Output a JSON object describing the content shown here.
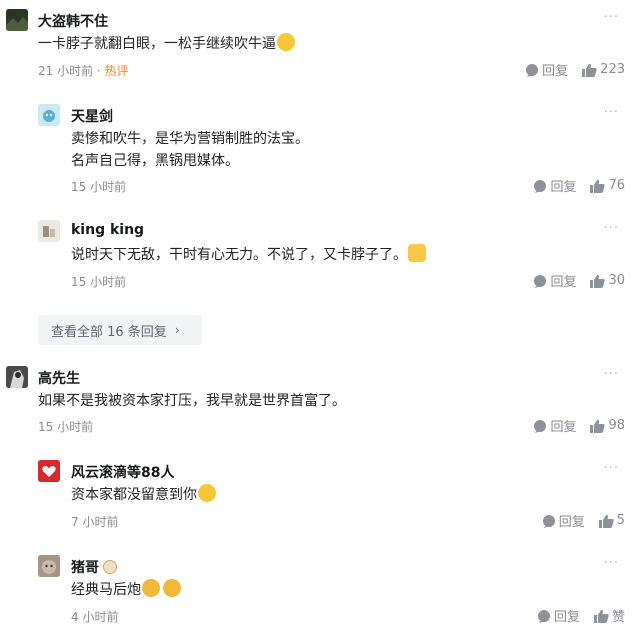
{
  "more_glyph": "···",
  "reply_label": "回复",
  "view_all": {
    "label": "查看全部 16 条回复",
    "chevron": "›"
  },
  "comments": [
    {
      "name": "大盗韩不住",
      "text": "一卡脖子就翻白眼，一松手继续吹牛逼",
      "time": "21 小时前",
      "tag": "热评",
      "likes": "223"
    },
    {
      "name": "天星剑",
      "text_line1": "卖惨和吹牛，是华为营销制胜的法宝。",
      "text_line2": "名声自己得，黑锅甩媒体。",
      "time": "15 小时前",
      "likes": "76"
    },
    {
      "name": "king king",
      "text": "说时天下无敌，干时有心无力。不说了，又卡脖子了。",
      "time": "15 小时前",
      "likes": "30"
    },
    {
      "name": "高先生",
      "text": "如果不是我被资本家打压，我早就是世界首富了。",
      "time": "15 小时前",
      "likes": "98"
    },
    {
      "name": "风云滚滴等88人",
      "text": "资本家都没留意到你",
      "time": "7 小时前",
      "likes": "5"
    },
    {
      "name": "猪哥",
      "text": "经典马后炮",
      "time": "4 小时前",
      "likes": "赞"
    }
  ],
  "colors": {
    "hot": "#f68a1e",
    "meta": "#8a8a92",
    "icon": "#8f9199"
  }
}
